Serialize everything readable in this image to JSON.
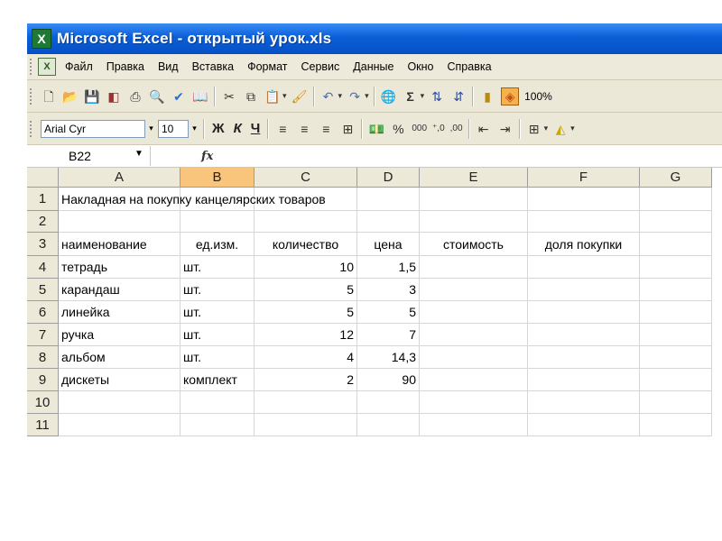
{
  "window": {
    "title": "Microsoft Excel - открытый урок.xls"
  },
  "menu": [
    "Файл",
    "Правка",
    "Вид",
    "Вставка",
    "Формат",
    "Сервис",
    "Данные",
    "Окно",
    "Справка"
  ],
  "standard_toolbar": {
    "icons": [
      "new-icon",
      "open-icon",
      "save-icon",
      "permission-icon",
      "print-icon",
      "print-preview-icon",
      "spelling-icon",
      "research-icon",
      "cut-icon",
      "copy-icon",
      "paste-icon",
      "format-painter-icon",
      "undo-icon",
      "redo-icon",
      "hyperlink-icon",
      "autosum-icon",
      "sort-ascending-icon",
      "sort-descending-icon",
      "chart-wizard-icon",
      "drawing-icon"
    ],
    "zoom": "100%"
  },
  "format_toolbar": {
    "font_name": "Arial Cyr",
    "font_size": "10",
    "bold": "Ж",
    "italic": "К",
    "underline": "Ч",
    "percent": "%",
    "thousands": "000",
    "inc_decimal": "⁺,0",
    "dec_decimal": ",00"
  },
  "formula_bar": {
    "name_box": "B22",
    "fx": "fx",
    "formula": ""
  },
  "sheet": {
    "columns": [
      "A",
      "B",
      "C",
      "D",
      "E",
      "F",
      "G"
    ],
    "selected_column": "B",
    "rows": [
      {
        "num": "1",
        "cells": [
          "Накладная на покупку канцелярских товаров",
          "",
          "",
          "",
          "",
          "",
          ""
        ]
      },
      {
        "num": "2",
        "cells": [
          "",
          "",
          "",
          "",
          "",
          "",
          ""
        ]
      },
      {
        "num": "3",
        "cells": [
          "наименование",
          "ед.изм.",
          "количество",
          "цена",
          "стоимость",
          "доля покупки",
          ""
        ]
      },
      {
        "num": "4",
        "cells": [
          "тетрадь",
          "шт.",
          "10",
          "1,5",
          "",
          "",
          ""
        ]
      },
      {
        "num": "5",
        "cells": [
          "карандаш",
          "шт.",
          "5",
          "3",
          "",
          "",
          ""
        ]
      },
      {
        "num": "6",
        "cells": [
          "линейка",
          "шт.",
          "5",
          "5",
          "",
          "",
          ""
        ]
      },
      {
        "num": "7",
        "cells": [
          "ручка",
          "шт.",
          "12",
          "7",
          "",
          "",
          ""
        ]
      },
      {
        "num": "8",
        "cells": [
          "альбом",
          "шт.",
          "4",
          "14,3",
          "",
          "",
          ""
        ]
      },
      {
        "num": "9",
        "cells": [
          "дискеты",
          "комплект",
          "2",
          "90",
          "",
          "",
          ""
        ]
      },
      {
        "num": "10",
        "cells": [
          "",
          "",
          "",
          "",
          "",
          "",
          ""
        ]
      },
      {
        "num": "11",
        "cells": [
          "",
          "",
          "",
          "",
          "",
          "",
          ""
        ]
      }
    ]
  }
}
